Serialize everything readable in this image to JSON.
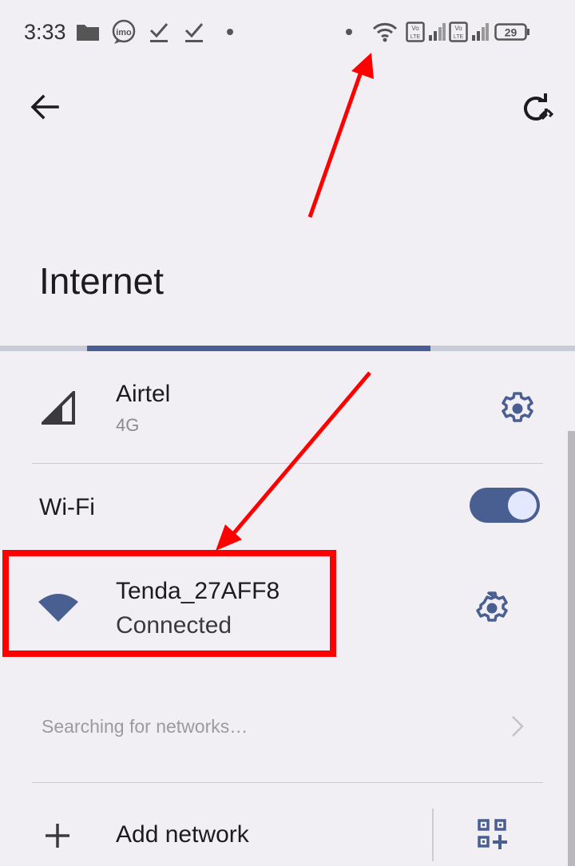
{
  "status_bar": {
    "time": "3:33",
    "left_icons": [
      "folder-icon",
      "imo-icon",
      "check-download-icon",
      "check-download-icon",
      "dot-icon"
    ],
    "right_icons": [
      "dot-icon",
      "wifi-icon",
      "volte-icon",
      "signal-icon",
      "volte-icon",
      "signal-icon",
      "battery-icon"
    ],
    "battery": "29",
    "volte_label_top": "Vo",
    "volte_label_bottom": "LTE"
  },
  "toolbar": {
    "back_icon": "arrow-back-icon",
    "refresh_icon": "refresh-icon"
  },
  "page": {
    "title": "Internet"
  },
  "scan_progress": {
    "indeterminate": true
  },
  "mobile": {
    "name": "Airtel",
    "type": "4G"
  },
  "wifi": {
    "label": "Wi-Fi",
    "enabled": true
  },
  "connected_network": {
    "ssid": "Tenda_27AFF8",
    "status": "Connected"
  },
  "scanning": {
    "text": "Searching for networks…"
  },
  "add_network": {
    "label": "Add network"
  },
  "colors": {
    "accent": "#4a5f91",
    "background": "#f2eff4",
    "annotation_red": "#ff0000",
    "toggle_thumb": "#e3e8ff"
  }
}
